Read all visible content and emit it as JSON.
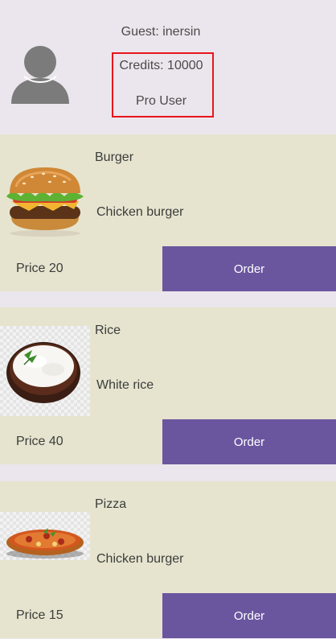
{
  "header": {
    "avatar_icon": "user-silhouette-icon",
    "guest_label": "Guest: inersin",
    "credits_label": "Credits: 10000",
    "plan_label": "Pro User",
    "highlight_color": "#e8141b"
  },
  "colors": {
    "background": "#ebe6ed",
    "card_background": "#e6e4ce",
    "order_button": "#6a569f",
    "order_text": "#ffffff"
  },
  "menu": {
    "items": [
      {
        "name": "Burger",
        "description": "Chicken burger",
        "price": "Price 20",
        "order_label": "Order",
        "image_icon": "burger-image"
      },
      {
        "name": "Rice",
        "description": "White rice",
        "price": "Price 40",
        "order_label": "Order",
        "image_icon": "rice-bowl-image"
      },
      {
        "name": "Pizza",
        "description": "Chicken burger",
        "price": "Price 15",
        "order_label": "Order",
        "image_icon": "pizza-image"
      }
    ]
  }
}
